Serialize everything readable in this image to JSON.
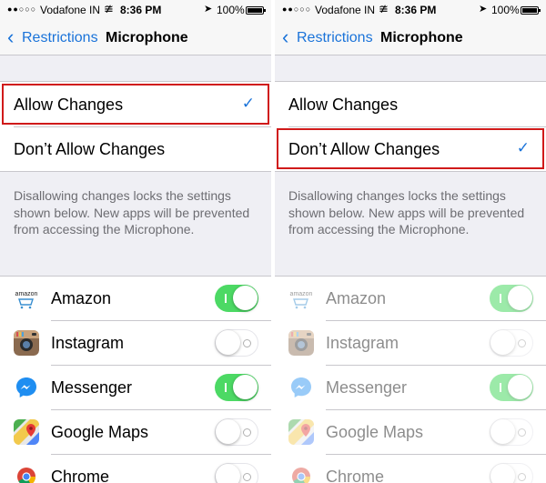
{
  "status": {
    "signal": "●●○○○",
    "carrier": "Vodafone IN",
    "time": "8:36 PM",
    "battery": "100%"
  },
  "nav": {
    "back_label": "Restrictions",
    "title": "Microphone"
  },
  "options": {
    "allow": "Allow Changes",
    "dont_allow": "Don’t Allow Changes"
  },
  "footer": "Disallowing changes locks the settings shown below. New apps will be prevented from accessing the Microphone.",
  "apps": [
    {
      "name": "Amazon",
      "icon": "amazon-icon",
      "logo_text": "amazon"
    },
    {
      "name": "Instagram",
      "icon": "instagram-icon"
    },
    {
      "name": "Messenger",
      "icon": "messenger-icon"
    },
    {
      "name": "Google Maps",
      "icon": "google-maps-icon"
    },
    {
      "name": "Chrome",
      "icon": "chrome-icon"
    }
  ],
  "panels": [
    {
      "selected": "allow",
      "toggles": [
        true,
        false,
        true,
        false,
        false
      ]
    },
    {
      "selected": "dont_allow",
      "toggles": [
        true,
        false,
        true,
        false,
        false
      ]
    }
  ],
  "colors": {
    "accent": "#1a73d9",
    "toggle_on": "#4cd964",
    "highlight": "#d01a1a"
  }
}
